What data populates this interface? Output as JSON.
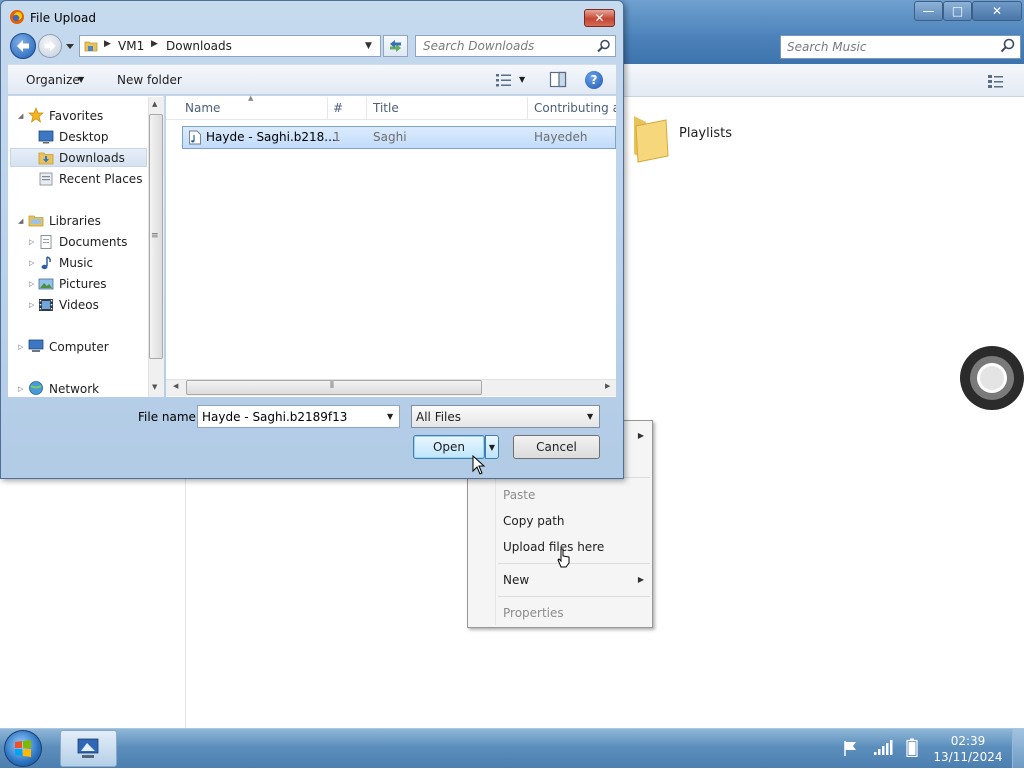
{
  "background_window": {
    "search_placeholder": "Search Music",
    "folder_label": "Playlists",
    "controls": {
      "minimize": "—",
      "maximize": "□",
      "close": "✕"
    }
  },
  "context_menu": {
    "items": [
      {
        "label": "Paste",
        "disabled": true
      },
      {
        "label": "Copy path",
        "disabled": false
      },
      {
        "label": "Upload files here",
        "disabled": false
      },
      {
        "label": "New",
        "disabled": false,
        "submenu": true
      },
      {
        "label": "Properties",
        "disabled": true
      }
    ]
  },
  "dialog": {
    "title": "File Upload",
    "close_label": "✕",
    "address": {
      "segments": [
        "VM1",
        "Downloads"
      ]
    },
    "search_placeholder": "Search Downloads",
    "toolbar": {
      "organize": "Organize",
      "new_folder": "New folder",
      "help": "?"
    },
    "nav": {
      "favorites": "Favorites",
      "favorites_items": [
        "Desktop",
        "Downloads",
        "Recent Places"
      ],
      "selected": "Downloads",
      "libraries": "Libraries",
      "libraries_items": [
        "Documents",
        "Music",
        "Pictures",
        "Videos"
      ],
      "computer": "Computer",
      "network": "Network"
    },
    "columns": [
      "Name",
      "#",
      "Title",
      "Contributing art"
    ],
    "files": [
      {
        "name": "Hayde - Saghi.b218...",
        "number": "1",
        "title": "Saghi",
        "artist": "Hayedeh",
        "selected": true
      }
    ],
    "file_name_label": "File name:",
    "file_name_value": "Hayde - Saghi.b2189f13",
    "file_type": "All Files",
    "open_label": "Open",
    "cancel_label": "Cancel"
  },
  "taskbar": {
    "time": "02:39",
    "date": "13/11/2024"
  },
  "colors": {
    "selection": "#cce4fc",
    "title_bar": "#b9d1ea",
    "taskbar": "#5d8fbd"
  }
}
